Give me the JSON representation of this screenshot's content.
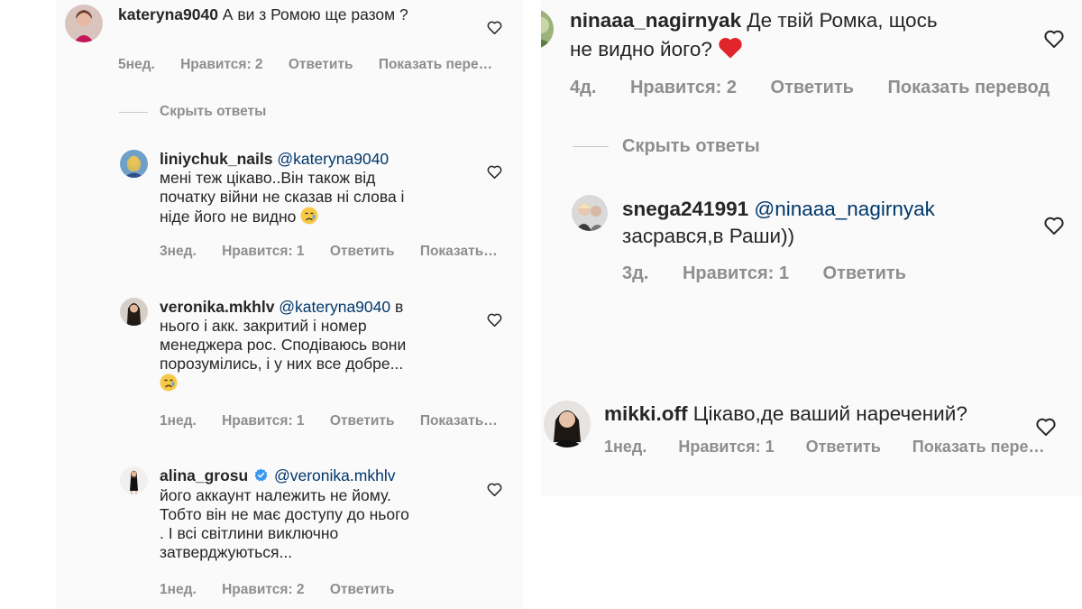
{
  "left": {
    "main_comment": {
      "username": "kateryna9040",
      "text": "А ви з Ромою ще разом ?",
      "time": "5нед.",
      "likes": "Нравится: 2",
      "reply": "Ответить",
      "translate": "Показать пере…"
    },
    "hide_replies": "Скрыть ответы",
    "replies": [
      {
        "username": "liniychuk_nails",
        "mention": "@kateryna9040",
        "lines": [
          "мені теж цікаво..Він також від",
          "початку війни не сказав ні слова і",
          "ніде його не видно"
        ],
        "time": "3нед.",
        "likes": "Нравится: 1",
        "reply": "Ответить",
        "translate": "Показать…"
      },
      {
        "username": "veronika.mkhlv",
        "mention": "@kateryna9040",
        "lines": [
          "в",
          "нього і акк.  закритий і номер",
          "менеджера рос. Сподіваюсь вони",
          "порозумілись, і у них все добре..."
        ],
        "time": "1нед.",
        "likes": "Нравится: 1",
        "reply": "Ответить",
        "translate": "Показать…"
      },
      {
        "username": "alina_grosu",
        "mention": "@veronika.mkhlv",
        "lines": [
          "його аккаунт належить не йому.",
          "Тобто він не має доступу до нього",
          ". І всі світлини виключно",
          "затверджуються..."
        ],
        "time": "1нед.",
        "likes": "Нравится: 2",
        "reply": "Ответить"
      }
    ]
  },
  "right": {
    "main_comment": {
      "username": "ninaaa_nagirnyak",
      "line1": "Де твій Ромка, щось",
      "line2": "не видно його?",
      "time": "4д.",
      "likes": "Нравится: 2",
      "reply": "Ответить",
      "translate": "Показать перевод"
    },
    "hide_replies": "Скрыть ответы",
    "reply": {
      "username": "snega241991",
      "mention": "@ninaaa_nagirnyak",
      "text": "засрався,в Раши))",
      "time": "3д.",
      "likes": "Нравится: 1",
      "reply": "Ответить"
    },
    "second_comment": {
      "username": "mikki.off",
      "text": "Цікаво,де ваший наречений?",
      "time": "1нед.",
      "likes": "Нравится: 1",
      "reply": "Ответить",
      "translate": "Показать пере…"
    }
  },
  "colors": {
    "text": "#262626",
    "secondary": "#8e8e8e",
    "mention": "#00376b",
    "panel_bg": "#fafafa",
    "verified": "#3897f0",
    "heart_emoji": "#e0262b"
  },
  "icons": [
    "heart-outline-icon",
    "verified-badge-icon",
    "crying-face-emoji",
    "red-heart-emoji"
  ]
}
